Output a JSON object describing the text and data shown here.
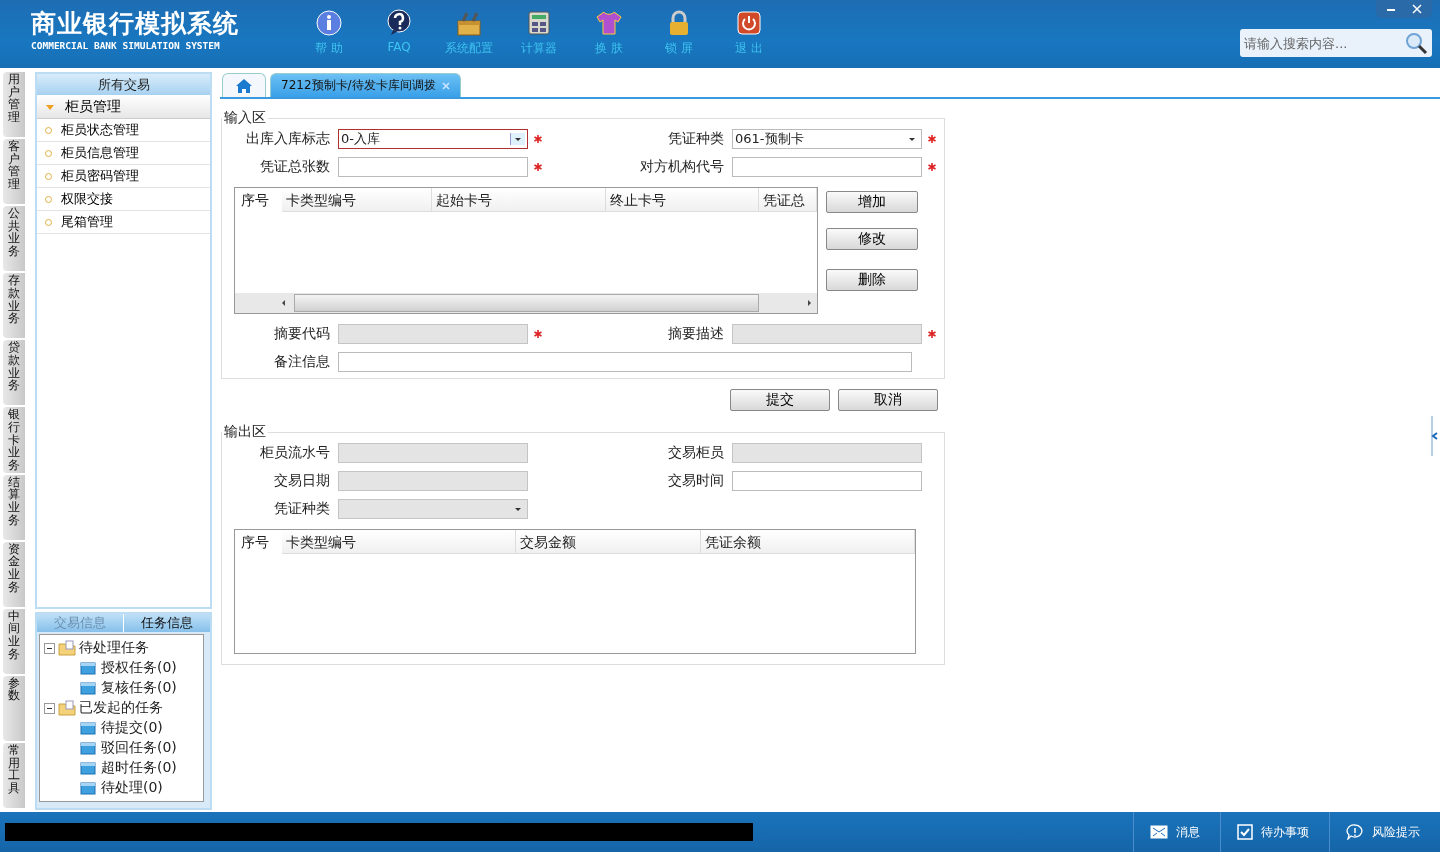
{
  "header": {
    "title": "商业银行模拟系统",
    "subtitle": "COMMERCIAL BANK SIMULATION SYSTEM",
    "toolbar": [
      {
        "kind": "help",
        "label": "帮 助"
      },
      {
        "kind": "faq",
        "label": "FAQ"
      },
      {
        "kind": "config",
        "label": "系统配置"
      },
      {
        "kind": "calculator",
        "label": "计算器"
      },
      {
        "kind": "skin",
        "label": "换 肤"
      },
      {
        "kind": "lock",
        "label": "锁 屏"
      },
      {
        "kind": "exit",
        "label": "退 出"
      }
    ],
    "search": {
      "placeholder": "请输入搜索内容..."
    }
  },
  "side_tabs": [
    "用户管理",
    "客户管理",
    "公共业务",
    "存款业务",
    "贷款业务",
    "银行卡业务",
    "结算业务",
    "资金业务",
    "中间业务",
    "参数",
    "常用工具"
  ],
  "sidebar": {
    "title": "所有交易",
    "group": {
      "label": "柜员管理",
      "expanded": true
    },
    "items": [
      "柜员状态管理",
      "柜员信息管理",
      "柜员密码管理",
      "权限交接",
      "尾箱管理"
    ]
  },
  "task_panel": {
    "tabs": [
      {
        "label": "交易信息",
        "selected": false
      },
      {
        "label": "任务信息",
        "selected": true
      }
    ],
    "tree": [
      {
        "label": "待处理任务",
        "expanded": true,
        "children": [
          {
            "label": "授权任务(0)"
          },
          {
            "label": "复核任务(0)"
          }
        ]
      },
      {
        "label": "已发起的任务",
        "expanded": true,
        "children": [
          {
            "label": "待提交(0)"
          },
          {
            "label": "驳回任务(0)"
          },
          {
            "label": "超时任务(0)"
          },
          {
            "label": "待处理(0)"
          }
        ]
      }
    ]
  },
  "tabs": [
    {
      "kind": "home",
      "selected": false
    },
    {
      "kind": "page",
      "label": "7212预制卡/待发卡库间调拨",
      "selected": true
    }
  ],
  "input_section": {
    "title": "输入区",
    "fields": [
      {
        "label": "出库入库标志",
        "kind": "select",
        "value": "0-入库",
        "required": true,
        "disabled": false,
        "invalid": true
      },
      {
        "label": "凭证种类",
        "kind": "select",
        "value": "061-预制卡",
        "required": true,
        "disabled": false,
        "invalid": false
      },
      {
        "label": "凭证总张数",
        "kind": "text",
        "required": true,
        "disabled": false,
        "invalid": false
      },
      {
        "label": "对方机构代号",
        "kind": "text",
        "required": true,
        "disabled": false,
        "invalid": false
      }
    ],
    "grid": {
      "columns": [
        "序号",
        "卡类型编号",
        "起始卡号",
        "终止卡号",
        "凭证总"
      ]
    },
    "grid_buttons": [
      "增加",
      "修改",
      "删除"
    ],
    "fields_after": [
      {
        "label": "摘要代码",
        "kind": "text",
        "required": true,
        "disabled": true,
        "invalid": false
      },
      {
        "label": "摘要描述",
        "kind": "text",
        "required": true,
        "disabled": true,
        "invalid": false
      }
    ],
    "remark": {
      "label": "备注信息"
    }
  },
  "actions": [
    "提交",
    "取消"
  ],
  "output_section": {
    "title": "输出区",
    "fields": [
      {
        "label": "柜员流水号",
        "kind": "text",
        "disabled": true,
        "invalid": false
      },
      {
        "label": "交易柜员",
        "kind": "text",
        "disabled": true,
        "invalid": false
      },
      {
        "label": "交易日期",
        "kind": "text",
        "disabled": true,
        "invalid": false
      },
      {
        "label": "交易时间",
        "kind": "text",
        "disabled": false,
        "invalid": false
      },
      {
        "label": "凭证种类",
        "kind": "select",
        "disabled": true,
        "invalid": false
      }
    ],
    "grid": {
      "columns": [
        "序号",
        "卡类型编号",
        "交易金额",
        "凭证余额"
      ]
    }
  },
  "status_bar": [
    {
      "kind": "message",
      "label": "消息"
    },
    {
      "kind": "todo",
      "label": "待办事项"
    },
    {
      "kind": "risk",
      "label": "风险提示"
    }
  ]
}
